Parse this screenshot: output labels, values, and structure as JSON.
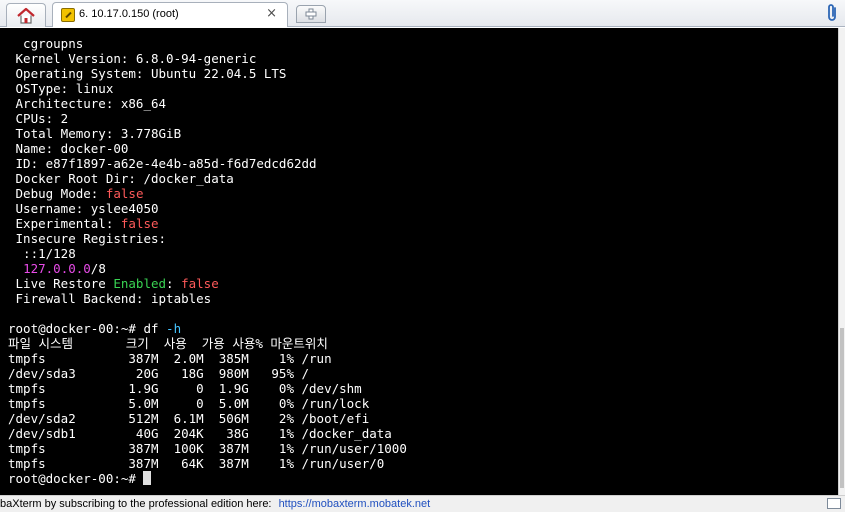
{
  "tabs": {
    "home_icon": "home-icon",
    "session_title": "6. 10.17.0.150 (root)",
    "close_glyph": "×",
    "new_tab_glyph": "+",
    "attach_icon": "paperclip-icon"
  },
  "colors": {
    "terminal_bg": "#000000",
    "text": "#ffffff",
    "false_value": "#ff5a5a",
    "enabled": "#39d353",
    "ip_value": "#e84be8",
    "flag": "#45c4ff"
  },
  "terminal": {
    "lines": [
      [
        {
          "t": "  cgroupns"
        }
      ],
      [
        {
          "t": " Kernel Version: 6.8.0-94-generic"
        }
      ],
      [
        {
          "t": " Operating System: Ubuntu 22.04.5 LTS"
        }
      ],
      [
        {
          "t": " OSType: linux"
        }
      ],
      [
        {
          "t": " Architecture: x86_64"
        }
      ],
      [
        {
          "t": " CPUs: 2"
        }
      ],
      [
        {
          "t": " Total Memory: 3.778GiB"
        }
      ],
      [
        {
          "t": " Name: docker-00"
        }
      ],
      [
        {
          "t": " ID: e87f1897-a62e-4e4b-a85d-f6d7edcd62dd"
        }
      ],
      [
        {
          "t": " Docker Root Dir: /docker_data"
        }
      ],
      [
        {
          "t": " Debug Mode: "
        },
        {
          "t": "false",
          "c": "red"
        }
      ],
      [
        {
          "t": " Username: yslee4050"
        }
      ],
      [
        {
          "t": " Experimental: "
        },
        {
          "t": "false",
          "c": "red"
        }
      ],
      [
        {
          "t": " Insecure Registries:"
        }
      ],
      [
        {
          "t": "  ::1/128"
        }
      ],
      [
        {
          "t": "  "
        },
        {
          "t": "127.0.0.0",
          "c": "magenta"
        },
        {
          "t": "/8"
        }
      ],
      [
        {
          "t": " Live Restore "
        },
        {
          "t": "Enabled",
          "c": "green"
        },
        {
          "t": ": "
        },
        {
          "t": "false",
          "c": "red"
        }
      ],
      [
        {
          "t": " Firewall Backend: iptables"
        }
      ],
      [
        {
          "t": ""
        }
      ],
      [
        {
          "t": "root@docker-00:~# df "
        },
        {
          "t": "-h",
          "c": "cyan"
        }
      ],
      [
        {
          "t": "파일 시스템       크기  사용  가용 사용% 마운트위치"
        }
      ],
      [
        {
          "t": "tmpfs           387M  2.0M  385M    1% /run"
        }
      ],
      [
        {
          "t": "/dev/sda3        20G   18G  980M   95% /"
        }
      ],
      [
        {
          "t": "tmpfs           1.9G     0  1.9G    0% /dev/shm"
        }
      ],
      [
        {
          "t": "tmpfs           5.0M     0  5.0M    0% /run/lock"
        }
      ],
      [
        {
          "t": "/dev/sda2       512M  6.1M  506M    2% /boot/efi"
        }
      ],
      [
        {
          "t": "/dev/sdb1        40G  204K   38G    1% /docker_data"
        }
      ],
      [
        {
          "t": "tmpfs           387M  100K  387M    1% /run/user/1000"
        }
      ],
      [
        {
          "t": "tmpfs           387M   64K  387M    1% /run/user/0"
        }
      ],
      [
        {
          "t": "root@docker-00:~# ",
          "cursor": true
        }
      ]
    ]
  },
  "status": {
    "message": "baXterm by subscribing to the professional edition here:",
    "link": "https://mobaxterm.mobatek.net"
  }
}
